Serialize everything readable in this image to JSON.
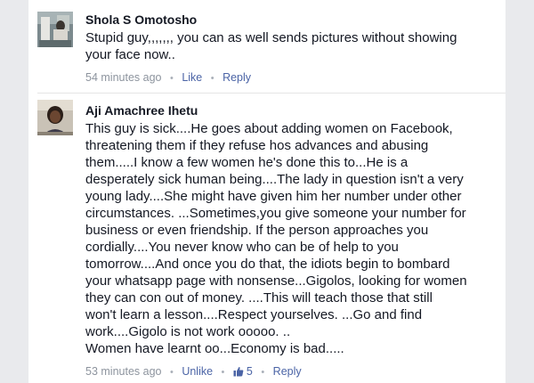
{
  "comments": [
    {
      "name": "Shola S Omotosho",
      "text": "Stupid guy,,,,,,, you can as well sends pictures without showing\nyour face now..",
      "time": "54 minutes ago",
      "like_label": "Like",
      "reply_label": "Reply"
    },
    {
      "name": "Aji Amachree Ihetu",
      "text": "This guy is sick....He goes about adding women on Facebook,\nthreatening them if they refuse hos advances and abusing\nthem.....I know a few women he's done this to...He is a\ndesperately sick human being....The lady in question isn't a very\nyoung lady....She might have given him her number under other\ncircumstances. ...Sometimes,you give someone your number for\nbusiness or even friendship. If the person approaches you\ncordially....You never know who can be of help to you\ntomorrow....And once you do that, the idiots begin to bombard\nyour whatsapp page with nonsense...Gigolos, looking for women\nthey can con out of money. ....This will teach those that still\nwon't learn a lesson....Respect yourselves. ...Go and find\nwork....Gigolo is not work ooooo. ..\nWomen have learnt oo...Economy is bad.....",
      "time": "53 minutes ago",
      "like_label": "Unlike",
      "like_count": "5",
      "reply_label": "Reply"
    }
  ]
}
